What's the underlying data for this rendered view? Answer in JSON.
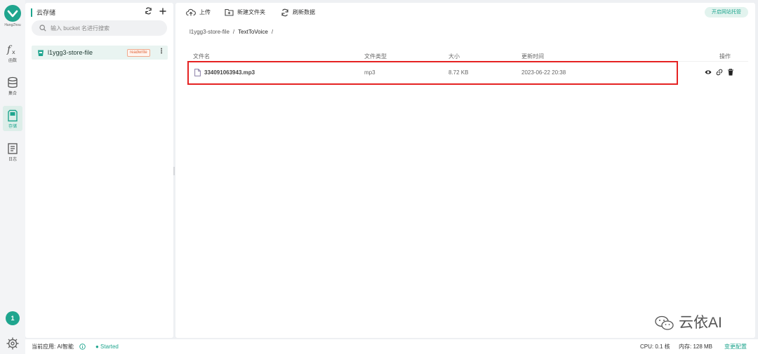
{
  "rail": {
    "logo_text": "HangZhou",
    "items": [
      {
        "label": "函数",
        "icon": "function-icon"
      },
      {
        "label": "集合",
        "icon": "database-icon"
      },
      {
        "label": "存储",
        "icon": "storage-icon"
      },
      {
        "label": "日志",
        "icon": "log-icon"
      }
    ],
    "badge": "1"
  },
  "side": {
    "title": "云存储",
    "search_placeholder": "输入 bucket 名进行搜索",
    "bucket": {
      "name": "l1ygg3-store-file",
      "permission": "readwrite"
    }
  },
  "toolbar": {
    "upload": "上传",
    "new_folder": "新建文件夹",
    "refresh": "刷新数据",
    "hosting": "开启网站托管"
  },
  "breadcrumb": {
    "root": "l1ygg3-store-file",
    "sep": "/",
    "current": "TextToVoice",
    "trail": "/"
  },
  "table": {
    "headers": [
      "文件名",
      "文件类型",
      "大小",
      "更新时间",
      "操作"
    ],
    "rows": [
      {
        "name": "334091063943.mp3",
        "type": "mp3",
        "size": "8.72 KB",
        "updated": "2023-06-22 20:38"
      }
    ]
  },
  "watermark": "云依AI",
  "status": {
    "app_label": "当前应用: AI智能",
    "state": "● Started",
    "cpu": "CPU: 0.1 核",
    "memory": "内存: 128 MB",
    "change": "变更配置"
  },
  "colors": {
    "accent": "#1fa58e",
    "highlight": "#e52222",
    "permission": "#e0673c"
  }
}
